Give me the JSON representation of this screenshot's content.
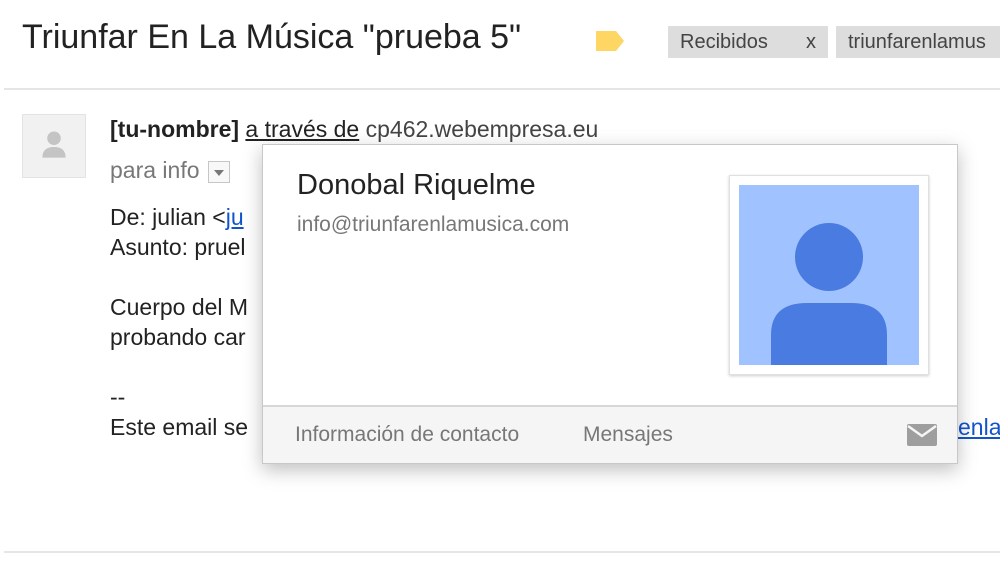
{
  "header": {
    "subject": "Triunfar En La Música \"prueba 5\"",
    "label_icon": "label-tag-icon",
    "label_icon_color": "#fdd663",
    "chips": {
      "inbox": {
        "label": "Recibidos",
        "remove": "x"
      },
      "folder": {
        "label": "triunfarenlamus"
      }
    }
  },
  "message": {
    "sender_name": "[tu-nombre]",
    "via_text": "a través de",
    "sender_domain": "cp462.webempresa.eu",
    "to_text": "para info",
    "body": {
      "from_prefix": "De: julian <",
      "from_link": "ju",
      "subject_line": "Asunto: pruel",
      "body_line1": "Cuerpo del M",
      "body_line2": "probando car",
      "signature_sep": "--",
      "footer_line": "Este email se",
      "right_link": "enla"
    }
  },
  "contact_card": {
    "name": "Donobal Riquelme",
    "email": "info@triunfarenlamusica.com",
    "photo_bg_color": "#a0c3ff",
    "photo_fg_color": "#4a7be0",
    "footer": {
      "contact_info": "Información de contacto",
      "messages": "Mensajes",
      "mail_icon": "mail-icon"
    }
  }
}
